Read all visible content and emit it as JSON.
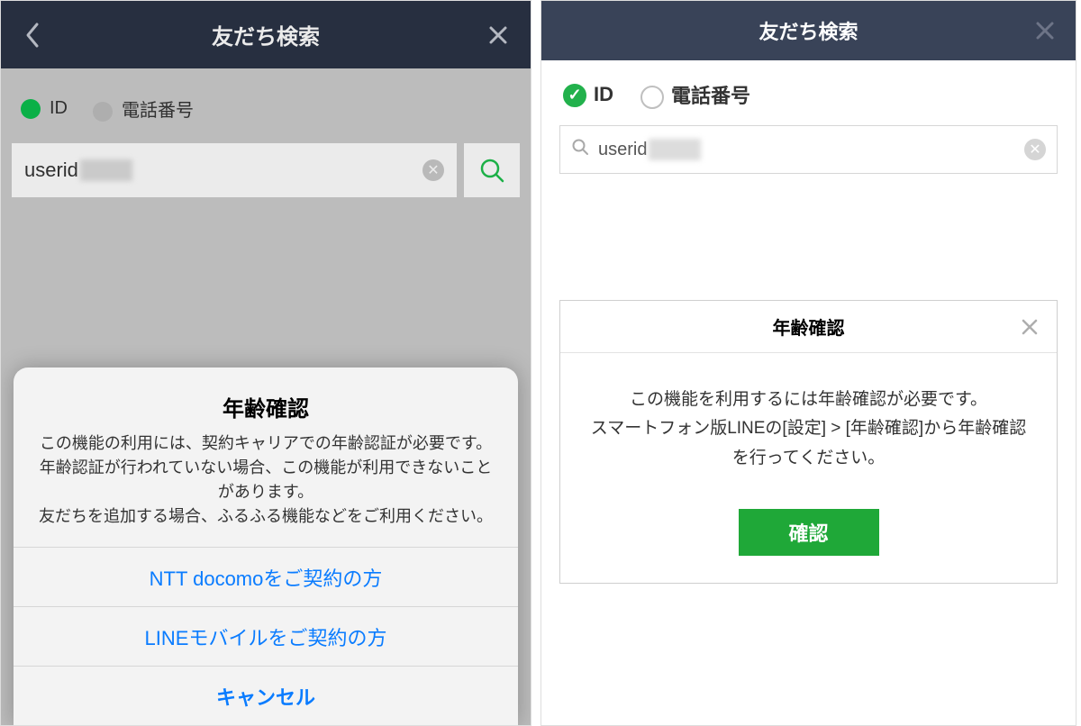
{
  "mobile": {
    "header": {
      "title": "友だち検索"
    },
    "radios": {
      "id": "ID",
      "phone": "電話番号"
    },
    "search": {
      "value": "userid"
    },
    "sheet": {
      "title": "年齢確認",
      "msg": "この機能の利用には、契約キャリアでの年齢認証が必要です。\n年齢認証が行われていない場合、この機能が利用できないことがあります。\n友だちを追加する場合、ふるふる機能などをご利用ください。",
      "opt_docomo": "NTT docomoをご契約の方",
      "opt_line": "LINEモバイルをご契約の方",
      "cancel": "キャンセル"
    }
  },
  "desktop": {
    "header": {
      "title": "友だち検索"
    },
    "radios": {
      "id": "ID",
      "phone": "電話番号"
    },
    "search": {
      "value": "userid"
    },
    "dialog": {
      "title": "年齢確認",
      "msg": "この機能を利用するには年齢確認が必要です。\nスマートフォン版LINEの[設定] > [年齢確認]から年齢確認を行ってください。",
      "ok": "確認"
    }
  }
}
